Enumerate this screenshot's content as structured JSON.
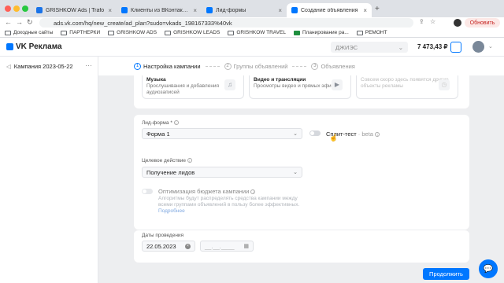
{
  "browser": {
    "tabs": [
      {
        "label": "GRISHKOW Ads | Trafo",
        "color": "#1a73e8"
      },
      {
        "label": "Клиенты из ВКонтакте | Иво...",
        "color": "#0077ff"
      },
      {
        "label": "Лид-формы",
        "color": "#0077ff"
      },
      {
        "label": "Создание объявления",
        "color": "#0077ff"
      }
    ],
    "url": "ads.vk.com/hq/new_create/ad_plan?sudo=vkads_198167333%40vk",
    "refresh_label": "Обновить",
    "bookmarks": [
      "Доходные сайты",
      "ПАРТНЕРКИ",
      "GRISHKOW ADS",
      "GRISHKOW LEADS",
      "GRISHKOW TRAVEL",
      "Планирование ра...",
      "РЕМОНТ"
    ]
  },
  "header": {
    "logo": "VK Реклама",
    "account": "ДЖИЭС",
    "balance": "7 473,43 ₽"
  },
  "sidebar": {
    "campaign": "Кампания 2023-05-22",
    "more": "···"
  },
  "steps": [
    {
      "num": "1",
      "label": "Настройка кампании"
    },
    {
      "num": "2",
      "label": "Группы объявлений"
    },
    {
      "num": "3",
      "label": "Объявления"
    }
  ],
  "formats": [
    {
      "title": "Музыка",
      "desc": "Прослушивания и добавления аудиозаписей",
      "icon": "♫"
    },
    {
      "title": "Видео и трансляции",
      "desc": "Просмотры видео и прямых эфиров",
      "icon": "▶"
    },
    {
      "title": "",
      "desc": "Совсем скоро здесь появятся другие объекты рекламы",
      "icon": "◷"
    }
  ],
  "form": {
    "leadform_label": "Лид-форма *",
    "leadform_value": "Форма 1",
    "split_label": "Сплит-тест",
    "split_beta": "· beta",
    "action_label": "Целевое действие",
    "action_value": "Получение лидов",
    "budget_opt_label": "Оптимизация бюджета кампании",
    "budget_opt_desc": "Алгоритмы будут распределять средства кампании между всеми группами объявлений в пользу более эффективных.",
    "more_link": "Подробнее",
    "dates_label": "Даты проведения",
    "date_start": "22.05.2023",
    "date_end_placeholder": "__.__.____"
  },
  "continue_label": "Продолжить"
}
